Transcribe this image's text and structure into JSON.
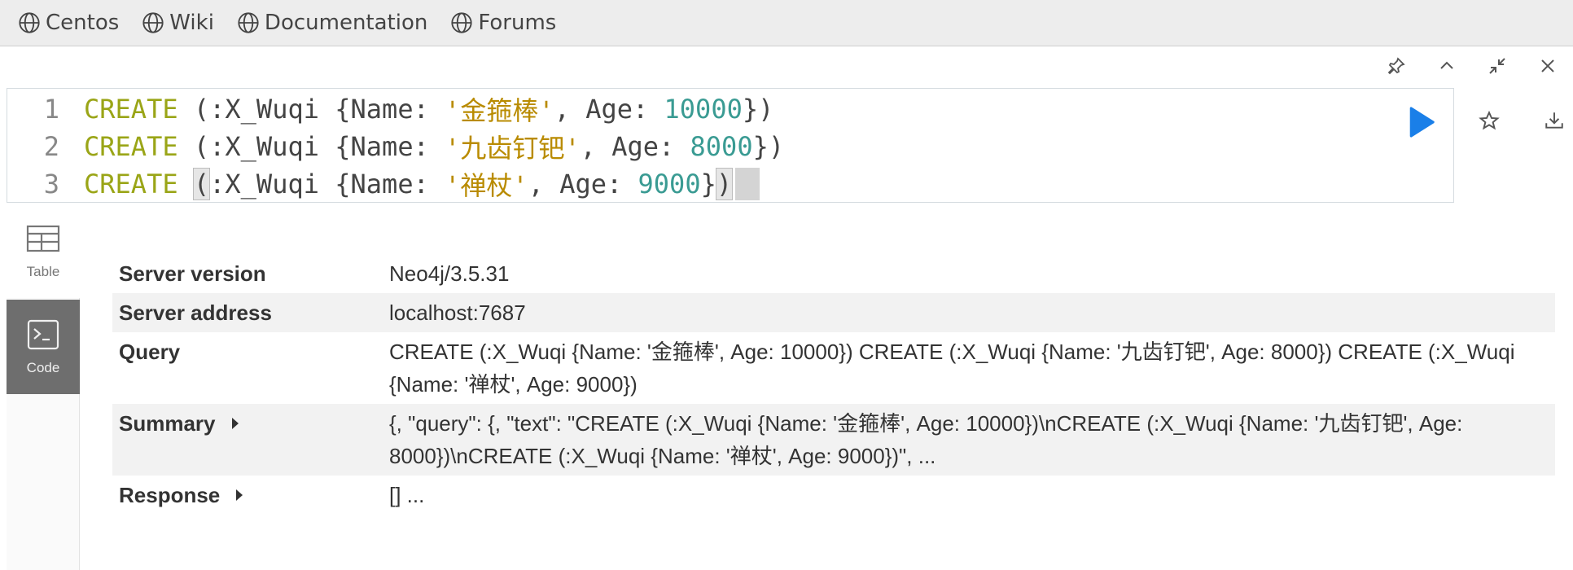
{
  "bookmarks": [
    {
      "label": "Centos",
      "icon": "globe-icon"
    },
    {
      "label": "Wiki",
      "icon": "globe-icon"
    },
    {
      "label": "Documentation",
      "icon": "globe-icon"
    },
    {
      "label": "Forums",
      "icon": "globe-icon"
    }
  ],
  "frame_controls": [
    "pin-icon",
    "chevron-up-icon",
    "collapse-icon",
    "close-icon"
  ],
  "editor": {
    "lines": [
      {
        "num": "1",
        "kw": "CREATE",
        "pre": " (:X_Wuqi {Name: ",
        "str": "'金箍棒'",
        "mid": ", Age: ",
        "num_val": "10000",
        "post": "})"
      },
      {
        "num": "2",
        "kw": "CREATE",
        "pre": " (:X_Wuqi {Name: ",
        "str": "'九齿钉钯'",
        "mid": ", Age: ",
        "num_val": "8000",
        "post": "})"
      },
      {
        "num": "3",
        "kw": "CREATE",
        "pre_space": " ",
        "open_bracket": "(",
        "pre": ":X_Wuqi {Name: ",
        "str": "'禅杖'",
        "mid": ", Age: ",
        "num_val": "9000",
        "close_brace": "}",
        "close_bracket": ")"
      }
    ]
  },
  "view_tabs": {
    "table": "Table",
    "code": "Code"
  },
  "result": {
    "rows": [
      {
        "key": "Server version",
        "value": "Neo4j/3.5.31"
      },
      {
        "key": "Server address",
        "value": "localhost:7687"
      },
      {
        "key": "Query",
        "value": "CREATE (:X_Wuqi {Name: '金箍棒', Age: 10000}) CREATE (:X_Wuqi {Name: '九齿钉钯', Age: 8000}) CREATE (:X_Wuqi {Name: '禅杖', Age: 9000})"
      },
      {
        "key": "Summary",
        "value": "{, \"query\": {, \"text\": \"CREATE (:X_Wuqi {Name: '金箍棒', Age: 10000})\\nCREATE (:X_Wuqi {Name: '九齿钉钯', Age: 8000})\\nCREATE (:X_Wuqi {Name: '禅杖', Age: 9000})\", ..."
      },
      {
        "key": "Response",
        "value": "[] ..."
      }
    ]
  },
  "colors": {
    "keyword": "#9aa517",
    "string": "#b98b00",
    "number": "#3a9b93",
    "run_button": "#1a7fe8",
    "code_tab_bg": "#6e6e6e"
  }
}
